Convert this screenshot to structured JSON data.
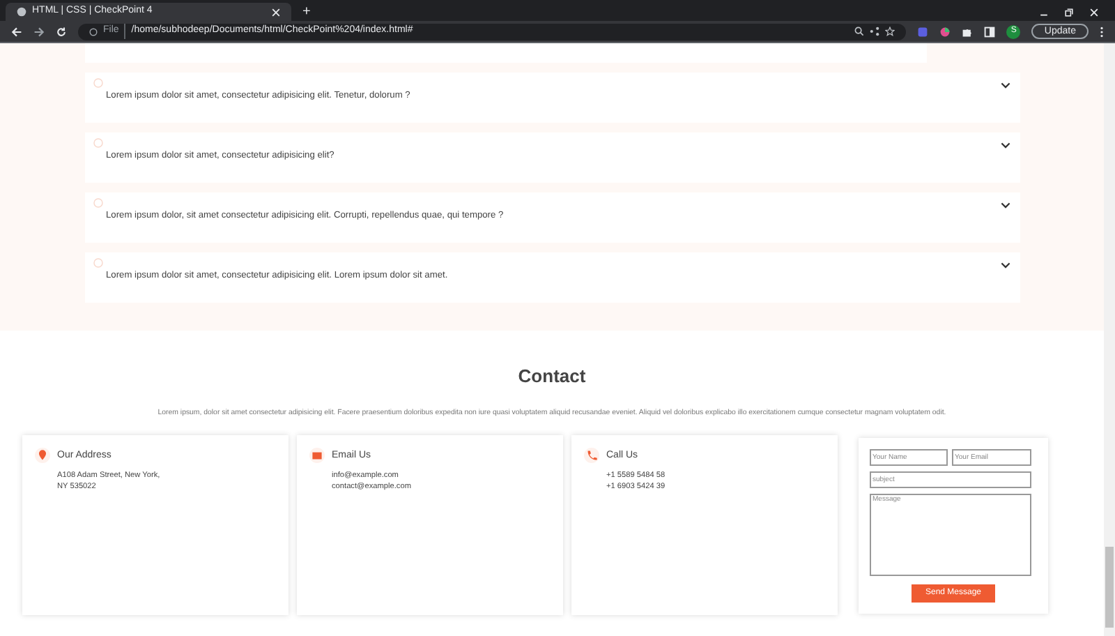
{
  "browser": {
    "tab_title": "HTML | CSS | CheckPoint 4",
    "new_tab": "+",
    "scheme": "File",
    "url": "/home/subhodeep/Documents/html/CheckPoint%204/index.html#",
    "profile": "S",
    "update": "Update"
  },
  "faq": [
    {
      "question": "Lorem ipsum dolor sit amet, consectetur adipisicing elit. Tenetur, dolorum ?",
      "expanded": false
    },
    {
      "question": "Lorem ipsum dolor sit amet, consectetur adipisicing elit?",
      "expanded": false
    },
    {
      "question": "Lorem ipsum dolor, sit amet consectetur adipisicing elit. Corrupti, repellendus quae, qui tempore ?",
      "expanded": false
    },
    {
      "question": "Lorem ipsum dolor sit amet, consectetur adipisicing elit. Lorem ipsum dolor sit amet.",
      "expanded": false
    }
  ],
  "contact": {
    "title": "Contact",
    "intro": "Lorem ipsum, dolor sit amet consectetur adipisicing elit. Facere praesentium doloribus expedita non iure quasi voluptatem aliquid recusandae eveniet. Aliquid vel doloribus explicabo illo exercitationem cumque consectetur magnam voluptatem odit.",
    "cards": [
      {
        "kind": "address",
        "title": "Our Address",
        "lines": [
          "A108 Adam Street, New York,",
          "NY 535022"
        ]
      },
      {
        "kind": "email",
        "title": "Email Us",
        "lines": [
          "info@example.com",
          "contact@example.com"
        ]
      },
      {
        "kind": "phone",
        "title": "Call Us",
        "lines": [
          "+1 5589 5484 58",
          "+1 6903 5424 39"
        ]
      }
    ],
    "form": {
      "name_placeholder": "Your Name",
      "email_placeholder": "Your Email",
      "subject_placeholder": "subject",
      "message_placeholder": "Message",
      "submit": "Send Message"
    }
  }
}
